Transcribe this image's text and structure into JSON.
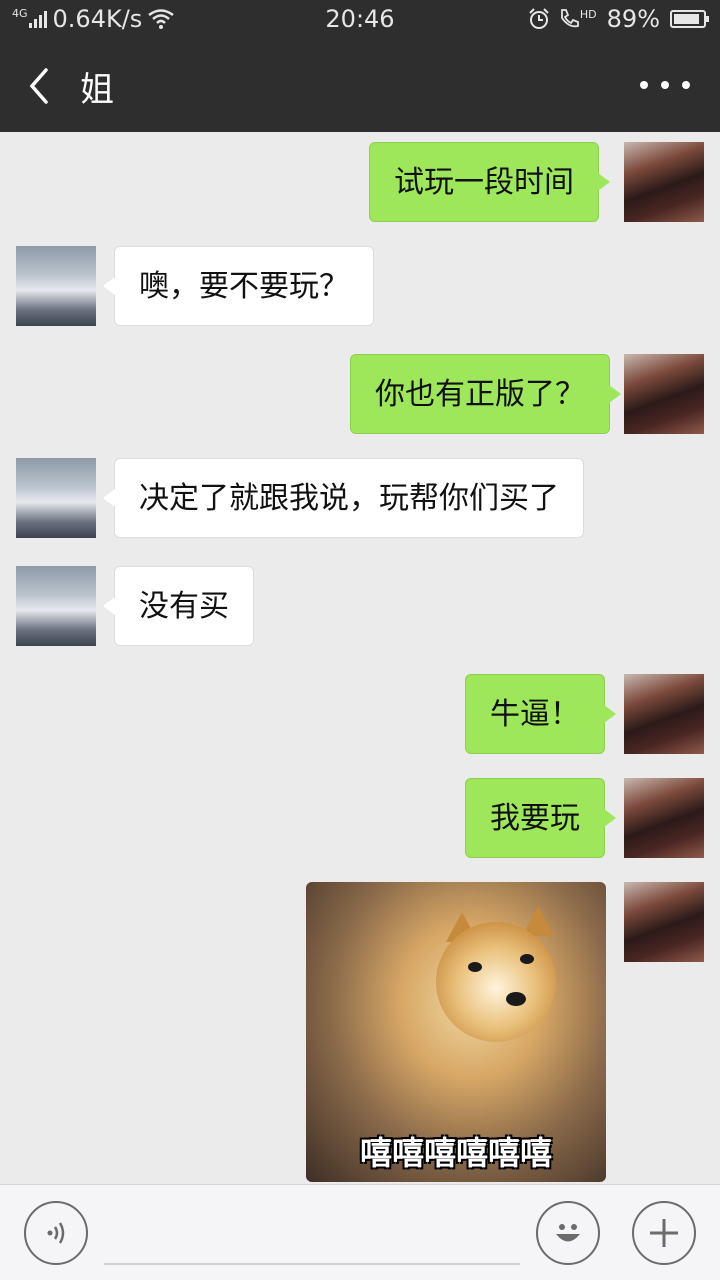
{
  "status_bar": {
    "network_type": "4G",
    "speed": "0.64K/s",
    "time": "20:46",
    "battery": "89%",
    "battery_level": 0.89,
    "hd_label": "HD"
  },
  "header": {
    "title": "姐",
    "back_icon": "chevron-left-icon",
    "more_icon": "more-dots-icon"
  },
  "messages": [
    {
      "sender": "me",
      "text": "试玩一段时间"
    },
    {
      "sender": "other",
      "text": "噢，要不要玩？"
    },
    {
      "sender": "me",
      "text": "你也有正版了？"
    },
    {
      "sender": "other",
      "text": "决定了就跟我说，玩帮你们买了"
    },
    {
      "sender": "other",
      "text": "没有买"
    },
    {
      "sender": "me",
      "text": "牛逼！"
    },
    {
      "sender": "me",
      "text": "我要玩"
    },
    {
      "sender": "me",
      "type": "sticker",
      "caption": "嘻嘻嘻嘻嘻嘻"
    }
  ],
  "input_bar": {
    "voice_icon": "voice-icon",
    "emoji_icon": "emoji-icon",
    "plus_icon": "plus-icon"
  },
  "colors": {
    "header_bg": "#2e2e2e",
    "chat_bg": "#ebebeb",
    "my_bubble": "#9fe75a",
    "other_bubble": "#ffffff"
  }
}
